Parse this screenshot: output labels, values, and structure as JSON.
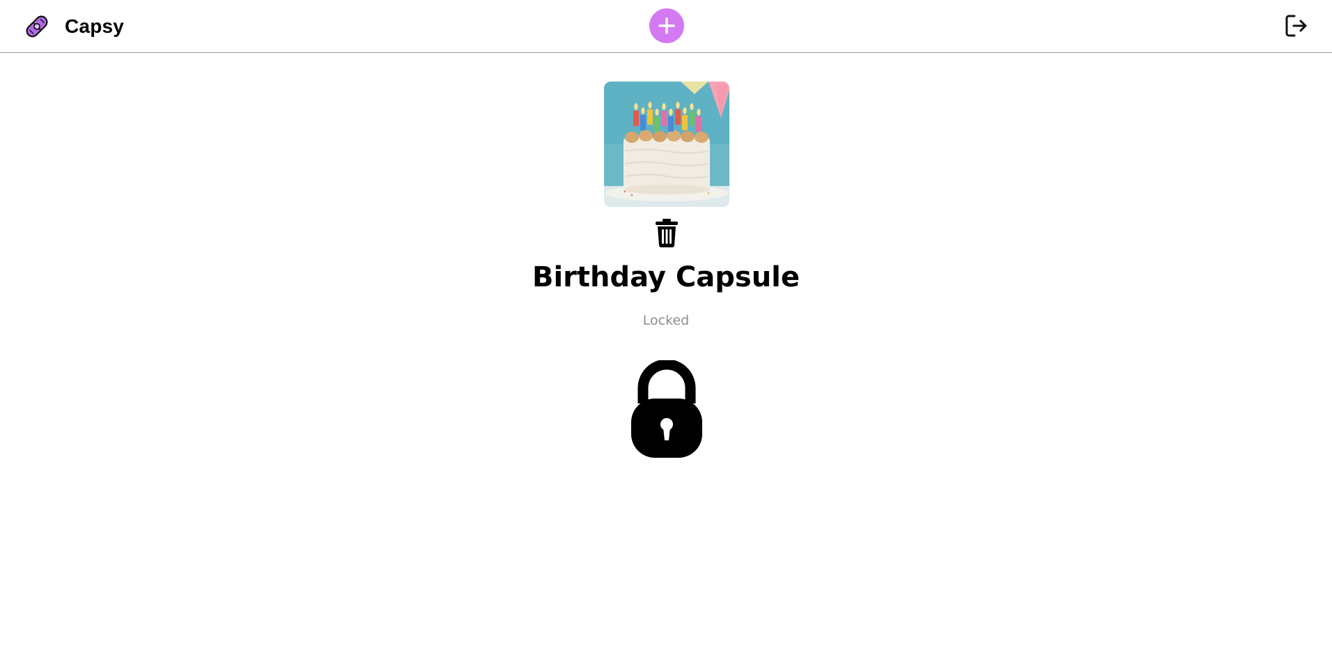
{
  "app": {
    "name": "Capsy",
    "logo_icon": "capsule-pill-icon",
    "accent_color": "#d37af2"
  },
  "header": {
    "add_button_icon": "plus-icon",
    "logout_button_icon": "logout-icon"
  },
  "capsule": {
    "title": "Birthday Capsule",
    "status": "Locked",
    "cover_image": "birthday-cake-photo",
    "delete_icon": "trash-icon",
    "status_icon": "padlock-icon"
  }
}
